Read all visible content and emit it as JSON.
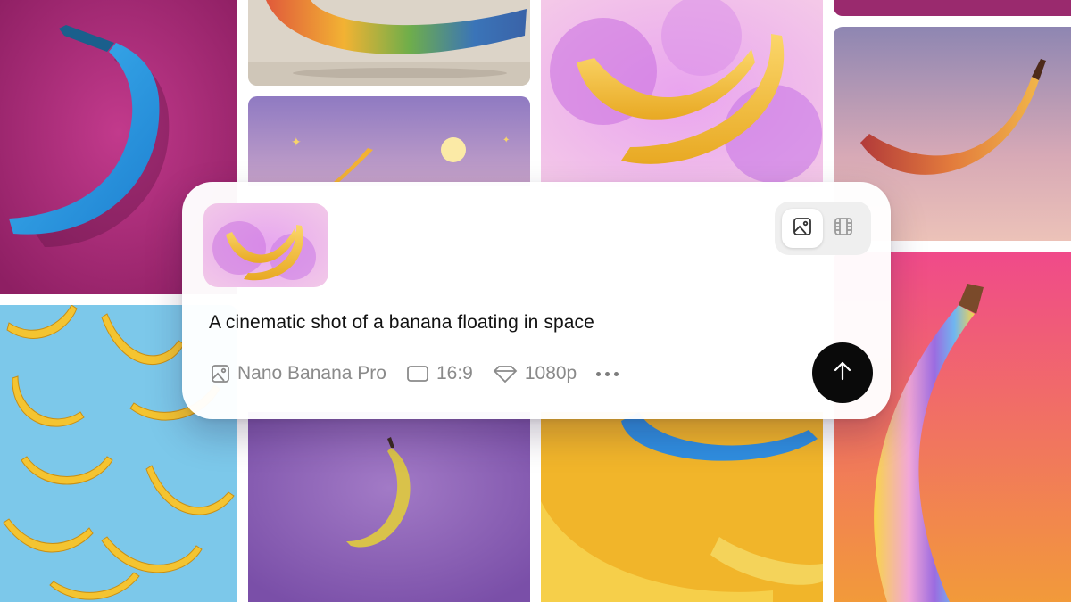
{
  "gallery": {
    "tiles": [
      {
        "name": "tile-blue-banana-magenta"
      },
      {
        "name": "tile-rainbow-banana"
      },
      {
        "name": "tile-pink-smoke-bananas"
      },
      {
        "name": "tile-top-right-strip"
      },
      {
        "name": "tile-sunset-banana"
      },
      {
        "name": "tile-night-sky-banana"
      },
      {
        "name": "tile-banana-pattern-blue"
      },
      {
        "name": "tile-floating-banana-purple"
      },
      {
        "name": "tile-blue-yellow-bananas"
      },
      {
        "name": "tile-iridescent-banana"
      }
    ]
  },
  "prompt_card": {
    "prompt": "A cinematic shot of a banana floating in space",
    "mode_toggle": {
      "image_icon": "image-icon",
      "video_icon": "film-icon",
      "selected": "image"
    },
    "options": {
      "model": {
        "label": "Nano Banana Pro",
        "icon": "image-icon"
      },
      "aspect_ratio": {
        "label": "16:9",
        "icon": "rectangle-icon"
      },
      "resolution": {
        "label": "1080p",
        "icon": "diamond-icon"
      }
    },
    "more_icon": "more-horizontal-icon",
    "send_icon": "arrow-up-icon"
  },
  "colors": {
    "send_button": "#0a0a0a",
    "option_text": "#8a8a8a",
    "prompt_text": "#111111"
  }
}
